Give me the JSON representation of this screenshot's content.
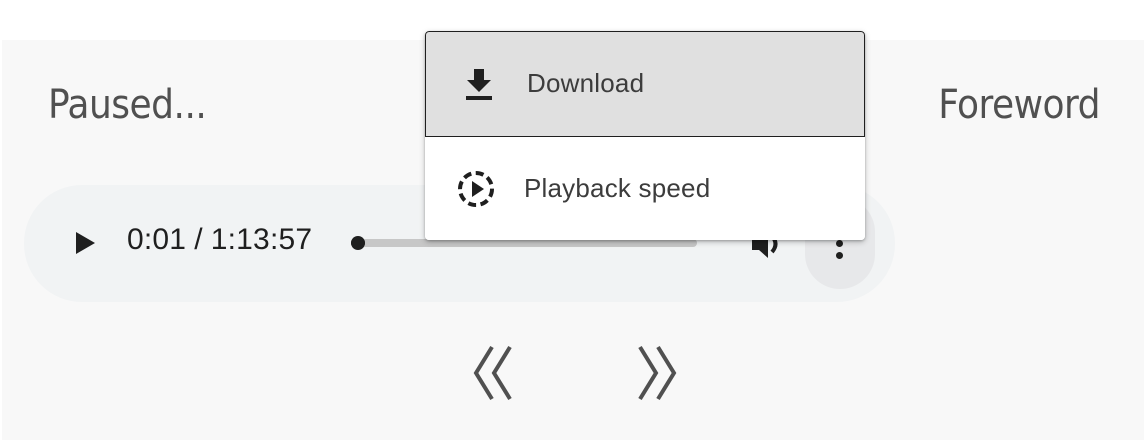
{
  "status": "Paused...",
  "chapter": "Foreword",
  "player": {
    "current_time": "0:01",
    "separator": "/",
    "duration": "1:13:57",
    "progress": 0.0002,
    "play_icon": "play-icon",
    "volume_icon": "volume-icon",
    "more_icon": "more-vertical-icon"
  },
  "menu": {
    "items": [
      {
        "label": "Download",
        "icon": "download-icon"
      },
      {
        "label": "Playback speed",
        "icon": "playback-speed-icon"
      }
    ]
  },
  "navigation": {
    "back_icon": "double-chevron-left-icon",
    "forward_icon": "double-chevron-right-icon"
  },
  "colors": {
    "panel": "#f8f8f8",
    "player_bg": "#f1f3f4",
    "text": "#505050",
    "menu_highlight": "#e0e0e0"
  }
}
